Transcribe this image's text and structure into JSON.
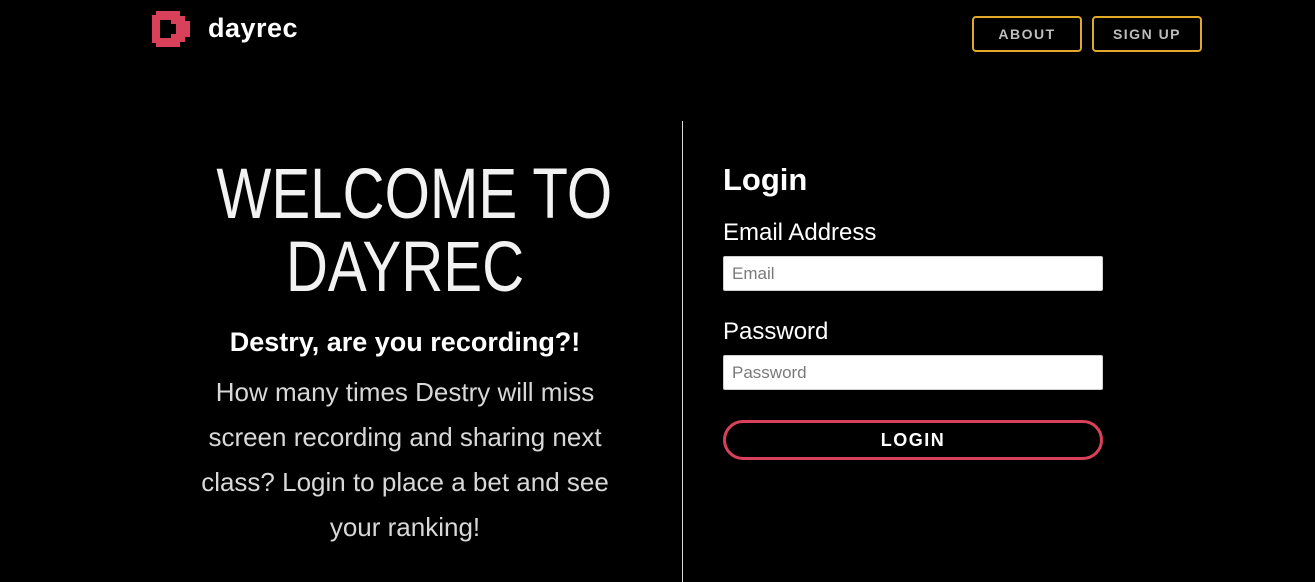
{
  "header": {
    "brand_name": "dayrec",
    "logo_icon": "dayrec-logo-icon",
    "nav": {
      "about_label": "ABOUT",
      "signup_label": "SIGN UP"
    }
  },
  "welcome": {
    "title_line1": "WELCOME TO",
    "title_line2": "DAYREC",
    "subtitle": "Destry, are you recording?!",
    "description": "How many times Destry will miss screen recording and sharing next class? Login to place a bet and see your ranking!"
  },
  "login": {
    "title": "Login",
    "email_label": "Email Address",
    "email_placeholder": "Email",
    "email_value": "",
    "password_label": "Password",
    "password_placeholder": "Password",
    "password_value": "",
    "submit_label": "LOGIN"
  },
  "colors": {
    "background": "#000000",
    "brand_accent": "#d9405a",
    "nav_border": "#e0a92a",
    "text": "#ffffff"
  }
}
